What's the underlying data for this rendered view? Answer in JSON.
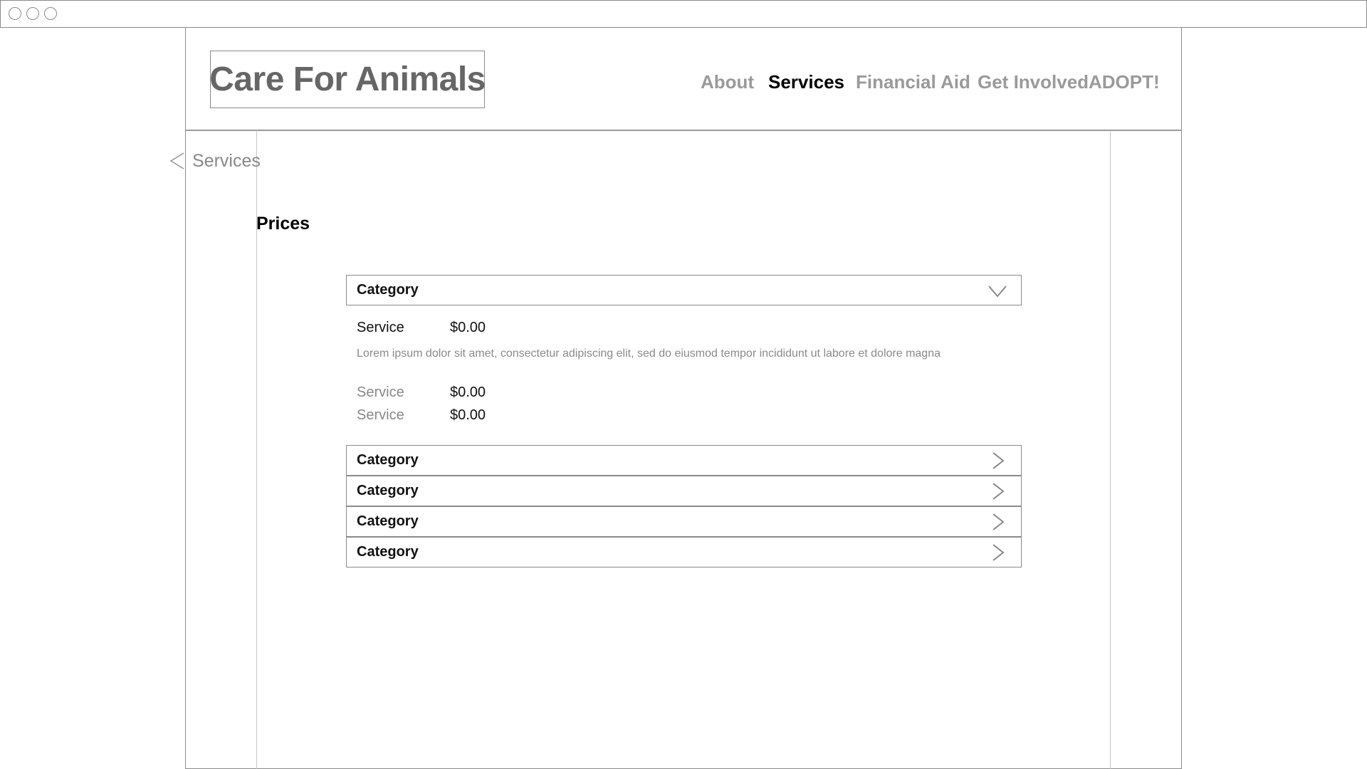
{
  "header": {
    "logo_text": "Care For Animals",
    "nav": [
      {
        "label": "About",
        "active": false
      },
      {
        "label": "Services",
        "active": true
      },
      {
        "label": "Financial Aid",
        "active": false
      },
      {
        "label": "Get Involved",
        "active": false
      },
      {
        "label": "ADOPT!",
        "active": false
      }
    ]
  },
  "breadcrumb": {
    "back_icon": "chevron-left-icon",
    "label": "Services"
  },
  "main": {
    "title": "Prices",
    "categories": [
      {
        "label": "Category",
        "expanded": true,
        "icon": "chevron-down-icon",
        "services": [
          {
            "name": "Service",
            "price": "$0.00",
            "description": "Lorem ipsum dolor sit amet, consectetur adipiscing elit, sed do eiusmod tempor incididunt ut labore et dolore magna"
          },
          {
            "name": "Service",
            "price": "$0.00"
          },
          {
            "name": "Service",
            "price": "$0.00"
          }
        ]
      },
      {
        "label": "Category",
        "expanded": false,
        "icon": "chevron-right-icon"
      },
      {
        "label": "Category",
        "expanded": false,
        "icon": "chevron-right-icon"
      },
      {
        "label": "Category",
        "expanded": false,
        "icon": "chevron-right-icon"
      },
      {
        "label": "Category",
        "expanded": false,
        "icon": "chevron-right-icon"
      }
    ]
  },
  "colors": {
    "border": "#8a8a8a",
    "muted_text": "#9a9a9a",
    "active_text": "#000000",
    "logo_text": "#666666"
  }
}
